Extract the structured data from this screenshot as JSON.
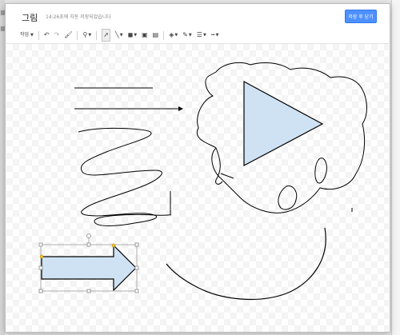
{
  "dialog": {
    "title": "그림",
    "status": "14:26초에 자동 저장되었습니다",
    "save_button": "저장 후 닫기"
  },
  "toolbar": {
    "actions_label": "작업",
    "items": [
      "actions-menu",
      "undo-icon",
      "redo-icon",
      "paint-format-icon",
      "zoom-icon",
      "select-icon",
      "line-icon",
      "shape-icon",
      "text-box-icon",
      "image-icon",
      "fill-color-icon",
      "line-color-icon",
      "line-weight-icon",
      "line-dash-icon"
    ]
  },
  "colors": {
    "accent": "#4d90fe",
    "shape_fill": "#cfe2f3",
    "shape_stroke": "#000000"
  },
  "canvas": {
    "shapes": [
      "line",
      "arrow-line",
      "freehand-zigzag",
      "triangle",
      "freehand-loop",
      "freehand-arc",
      "block-arrow"
    ]
  }
}
